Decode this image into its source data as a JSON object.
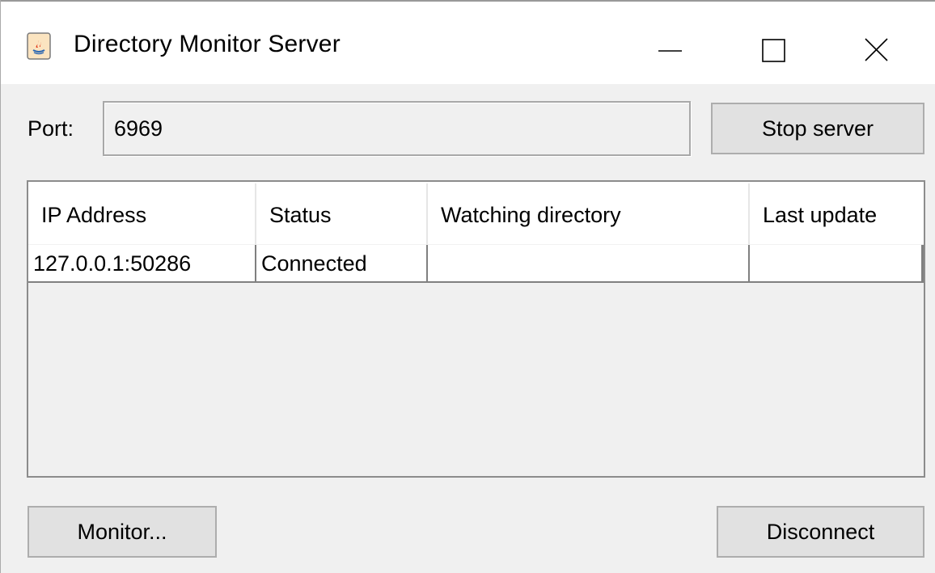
{
  "window": {
    "title": "Directory Monitor Server",
    "icon": "java-icon",
    "controls": [
      "minimize-icon",
      "maximize-icon",
      "close-icon"
    ]
  },
  "port": {
    "label": "Port:",
    "value": "6969"
  },
  "buttons": {
    "stop_server": "Stop server",
    "monitor": "Monitor...",
    "disconnect": "Disconnect"
  },
  "table": {
    "columns": [
      "IP Address",
      "Status",
      "Watching directory",
      "Last update"
    ],
    "rows": [
      [
        "127.0.0.1:50286",
        "Connected",
        "",
        ""
      ]
    ]
  },
  "colors": {
    "window_bg": "#f0f0f0",
    "titlebar_bg": "#ffffff",
    "button_bg": "#e1e1e1",
    "button_border": "#adadad"
  }
}
